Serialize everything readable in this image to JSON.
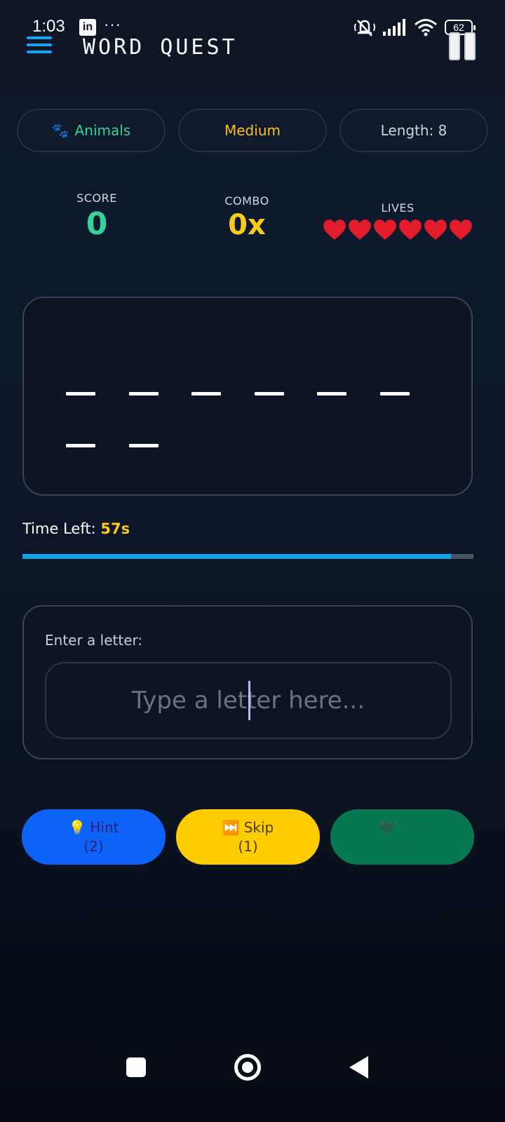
{
  "status_bar": {
    "time": "1:03",
    "app_icon": "linkedin-icon",
    "more": "···",
    "battery": "62",
    "icons": [
      "mute-icon",
      "signal-icon",
      "wifi-icon",
      "battery-icon"
    ]
  },
  "header": {
    "title": "WORD QUEST",
    "menu_icon": "hamburger-menu-icon",
    "pause_icon": "pause-icon"
  },
  "chips": {
    "category_icon": "🐾",
    "category": "Animals",
    "difficulty": "Medium",
    "length": "Length: 8"
  },
  "stats": {
    "score_label": "SCORE",
    "score": "0",
    "combo_label": "COMBO",
    "combo": "0x",
    "lives_label": "LIVES",
    "lives": 6
  },
  "word": {
    "revealed": [
      "",
      "",
      "",
      "",
      "",
      "",
      "",
      ""
    ]
  },
  "timer": {
    "label": "Time Left:",
    "value": "57s",
    "fraction": 0.95
  },
  "input": {
    "label": "Enter a letter:",
    "placeholder": "Type a letter here...",
    "value": ""
  },
  "powerups": {
    "hint": {
      "icon": "💡",
      "label": "Hint",
      "count": "(2)"
    },
    "skip": {
      "icon": "⏭️",
      "label": "Skip",
      "count": "(1)"
    },
    "life": {
      "icon": "🖤",
      "label": "Life",
      "count": "(1)"
    }
  },
  "colors": {
    "accent": "#1aa3f5",
    "score": "#34d399",
    "combo": "#facc15",
    "hint": "#0d63f8",
    "skip": "#ffcc00",
    "life": "#067851"
  }
}
